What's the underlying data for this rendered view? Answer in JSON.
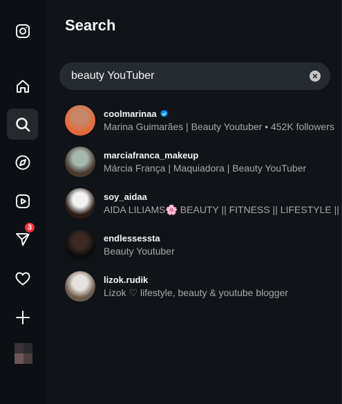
{
  "panel": {
    "title": "Search"
  },
  "search": {
    "value": "beauty YouTuber"
  },
  "sidebar": {
    "items": [
      {
        "name": "instagram-logo-icon"
      },
      {
        "name": "home-icon"
      },
      {
        "name": "search-icon"
      },
      {
        "name": "explore-icon"
      },
      {
        "name": "reels-icon"
      },
      {
        "name": "messages-icon",
        "badge": "3"
      },
      {
        "name": "notifications-icon"
      },
      {
        "name": "create-icon"
      },
      {
        "name": "profile-avatar"
      }
    ]
  },
  "results": [
    {
      "username": "coolmarinaa",
      "verified": true,
      "description": "Marina Guimarães | Beauty Youtuber • 452K followers",
      "avatar_colors": [
        "#c9876a",
        "#e46a3a"
      ]
    },
    {
      "username": "marciafranca_makeup",
      "verified": false,
      "description": "Márcia França | Maquiadora | Beauty YouTuber",
      "avatar_colors": [
        "#a5b8b0",
        "#4a3a30"
      ]
    },
    {
      "username": "soy_aidaa",
      "verified": false,
      "description": "AIDA LILIAMS🌸 BEAUTY || FITNESS || LIFESTYLE || YOUTUBER",
      "avatar_colors": [
        "#f1f1f1",
        "#2a1d18"
      ]
    },
    {
      "username": "endlessessta",
      "verified": false,
      "description": "Beauty Youtuber",
      "avatar_colors": [
        "#3b2a24",
        "#0c0c0c"
      ]
    },
    {
      "username": "lizok.rudik",
      "verified": false,
      "description": "Lizok ♡ lifestyle, beauty & youtube blogger",
      "avatar_colors": [
        "#e6e2dd",
        "#6b5a4e"
      ]
    }
  ]
}
